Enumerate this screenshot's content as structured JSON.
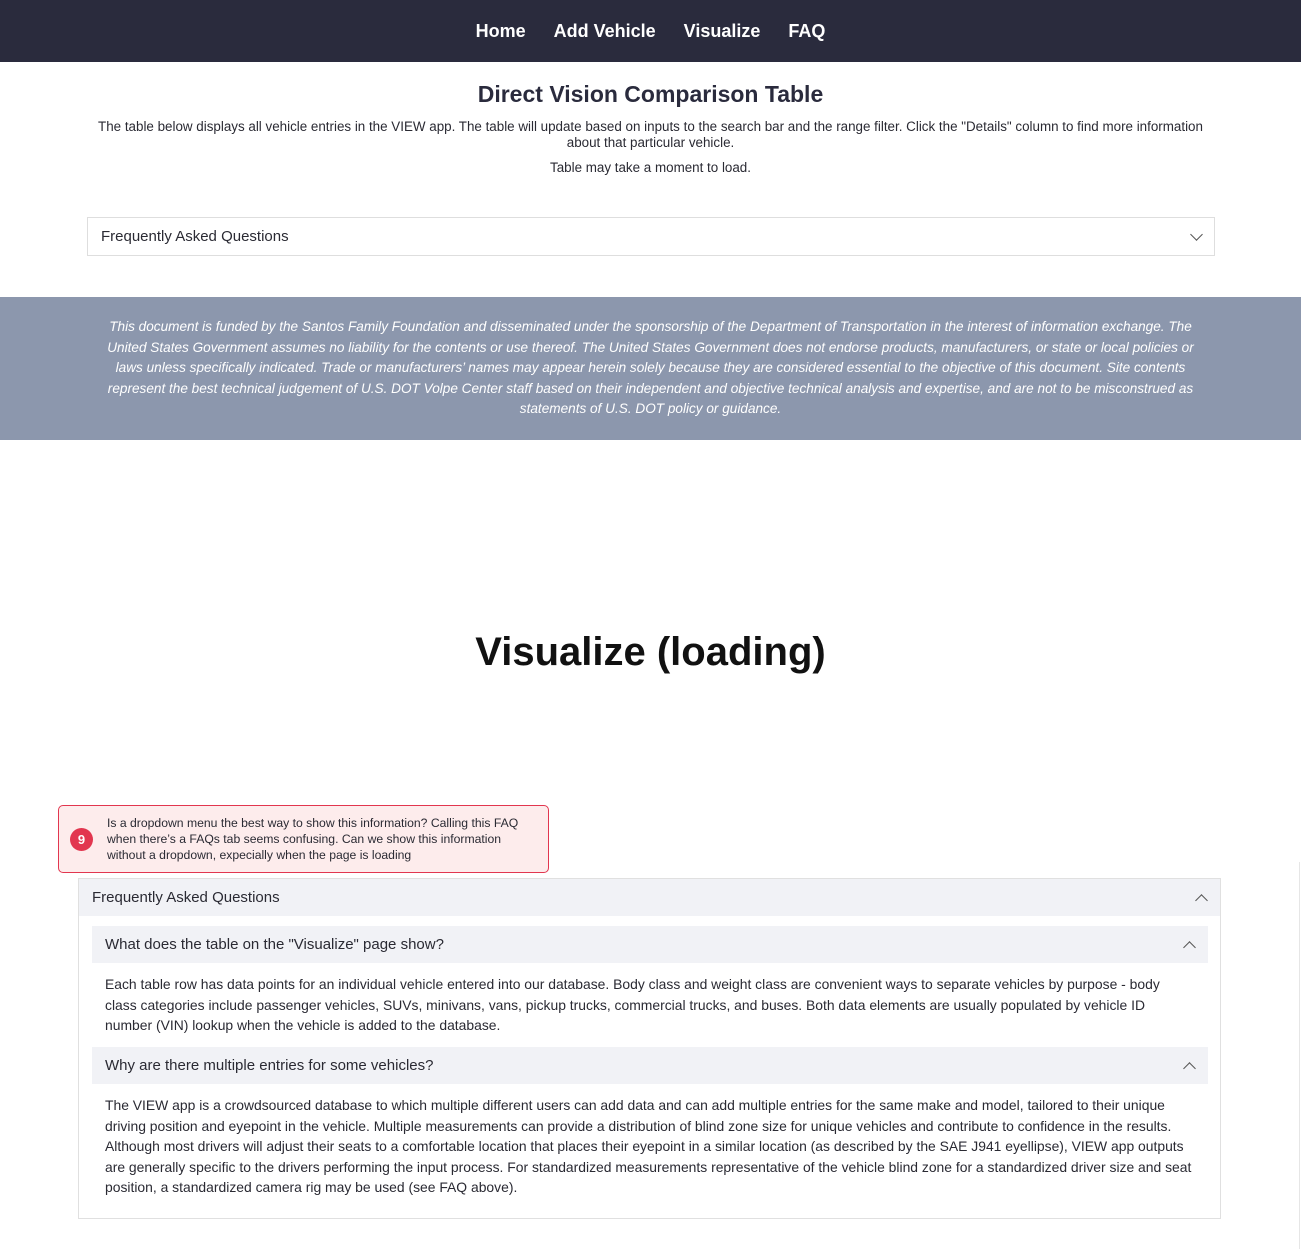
{
  "nav": {
    "items": [
      "Home",
      "Add Vehicle",
      "Visualize",
      "FAQ"
    ]
  },
  "page": {
    "title": "Direct Vision Comparison Table",
    "intro": "The table below displays all vehicle entries in the VIEW app. The table will update based on inputs to the search bar and the range filter. Click the \"Details\" column to find more information about that particular vehicle.",
    "load_note": "Table may take a moment to load."
  },
  "faq_collapsed": {
    "label": "Frequently Asked Questions",
    "icon": "chevron-down-icon"
  },
  "disclaimer": "This document is funded by the Santos Family Foundation and disseminated under the sponsorship of the Department of Transportation in the interest of information exchange. The United States Government assumes no liability for the contents or use thereof. The United States Government does not endorse products, manufacturers, or state or local policies or laws unless specifically indicated. Trade or manufacturers’ names may appear herein solely because they are considered essential to the objective of this document. Site contents represent the best technical judgement of U.S. DOT Volpe Center staff based on their independent and objective technical analysis and expertise, and are not to be misconstrued as statements of U.S. DOT policy or guidance.",
  "section_label": "Visualize (loading)",
  "comment": {
    "number": "9",
    "text": "Is a dropdown menu the best way to show this information? Calling this FAQ when there’s a FAQs tab seems confusing. Can we show this information without a dropdown, expecially when the page is loading",
    "color": "#e2364f"
  },
  "faq_open": {
    "label": "Frequently Asked Questions",
    "icon": "chevron-up-icon",
    "questions": [
      {
        "question": "What does the table on the \"Visualize\" page show?",
        "answer": "Each table row has data points for an individual vehicle entered into our database. Body class and weight class are convenient ways to separate vehicles by purpose - body class categories include passenger vehicles, SUVs, minivans, vans, pickup trucks, commercial trucks, and buses. Both data elements are usually populated by vehicle ID number (VIN) lookup when the vehicle is added to the database."
      },
      {
        "question": "Why are there multiple entries for some vehicles?",
        "answer": "The VIEW app is a crowdsourced database to which multiple different users can add data and can add multiple entries for the same make and model, tailored to their unique driving position and eyepoint in the vehicle. Multiple measurements can provide a distribution of blind zone size for unique vehicles and contribute to confidence in the results. Although most drivers will adjust their seats to a comfortable location that places their eyepoint in a similar location (as described by the SAE J941 eyellipse), VIEW app outputs are generally specific to the drivers performing the input process. For standardized measurements representative of the vehicle blind zone for a standardized driver size and seat position, a standardized camera rig may be used (see FAQ above)."
      }
    ]
  },
  "colors": {
    "navbar": "#2a2b3d",
    "disclaimer_bg": "#8c97ad",
    "accordion_header": "#f1f2f6",
    "comment_bg": "#fdecec"
  }
}
